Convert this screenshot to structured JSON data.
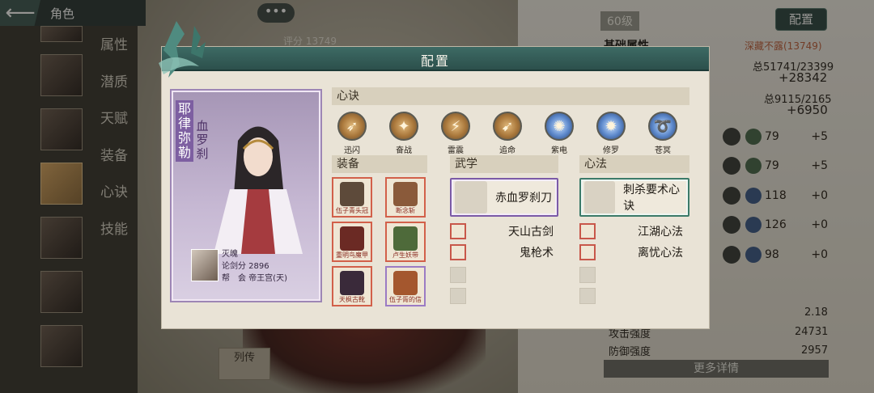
{
  "topbar": {
    "back_icon": "arrow-left-icon",
    "title": "角色",
    "chat": "•••"
  },
  "sidemenu": [
    "属性",
    "潜质",
    "天赋",
    "装备",
    "心诀",
    "技能"
  ],
  "background": {
    "level": "60级",
    "config_button": "配置",
    "score": "评分 13749",
    "basic_title": "基础属性",
    "hidden": "深藏不露(13749)",
    "total1": "总51741/23399",
    "bonus1": "+28342",
    "total2": "总9115/2165",
    "bonus2": "+6950",
    "stats": [
      {
        "val": "79",
        "plus": "+5"
      },
      {
        "val": "79",
        "plus": "+5"
      },
      {
        "val": "118",
        "plus": "+0"
      },
      {
        "val": "126",
        "plus": "+0"
      },
      {
        "val": "98",
        "plus": "+0"
      }
    ],
    "lower": [
      {
        "label": "",
        "value": "2.18"
      },
      {
        "label": "攻击强度",
        "value": "24731"
      },
      {
        "label": "防御强度",
        "value": "2957"
      }
    ],
    "more_button": "更多详情",
    "bio_button": "列传"
  },
  "dialog": {
    "title": "配置",
    "hero": {
      "name": "耶律弥勒",
      "title": "血罗刹",
      "guild_label": "灭魄",
      "score": "论剑分 2896",
      "gang": "帮　会 帝王宫(天)"
    },
    "sections": {
      "skills": "心诀",
      "equip": "装备",
      "martial": "武学",
      "mind": "心法"
    },
    "skills": [
      {
        "label": "迅闪",
        "icon": "dash-icon",
        "tone": "gold"
      },
      {
        "label": "奋战",
        "icon": "fight-icon",
        "tone": "gold"
      },
      {
        "label": "雷震",
        "icon": "thunder-icon",
        "tone": "gold"
      },
      {
        "label": "追命",
        "icon": "chase-icon",
        "tone": "gold"
      },
      {
        "label": "紫电",
        "icon": "lightning-icon",
        "tone": "blue"
      },
      {
        "label": "修罗",
        "icon": "asura-icon",
        "tone": "blue"
      },
      {
        "label": "苍冥",
        "icon": "swirl-icon",
        "tone": "blue"
      }
    ],
    "equip": [
      {
        "label": "伍子青头冠",
        "tone": "red"
      },
      {
        "label": "断念斩",
        "tone": "red"
      },
      {
        "label": "重明鸟魔甲",
        "tone": "red"
      },
      {
        "label": "卢生妖带",
        "tone": "red"
      },
      {
        "label": "天枫古靴",
        "tone": "red"
      },
      {
        "label": "伍子胥的信",
        "tone": "purple"
      }
    ],
    "martial_main": "赤血罗刹刀",
    "martial_sub": [
      "天山古剑",
      "鬼枪术"
    ],
    "mind_main": "刺杀要术心诀",
    "mind_sub": [
      "江湖心法",
      "离忧心法"
    ]
  },
  "colors": {
    "accent": "#2c504c",
    "purple": "#7b5aa6",
    "green": "#3b7a68"
  }
}
